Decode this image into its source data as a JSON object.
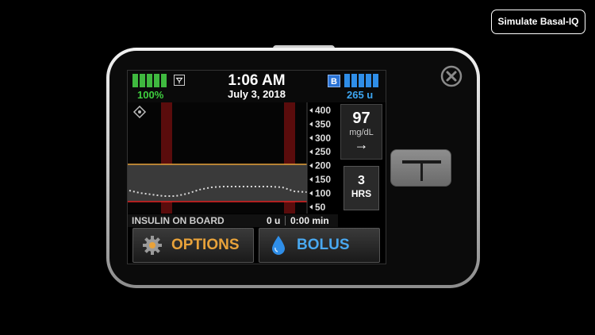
{
  "simulate_button": "Simulate Basal-IQ",
  "status": {
    "battery_percent": "100%",
    "battery_level": 1.0,
    "time": "1:06 AM",
    "date": "July 3, 2018",
    "badge": "B",
    "insulin_units": "265 u"
  },
  "graph": {
    "y_ticks": [
      "400",
      "350",
      "300",
      "250",
      "200",
      "150",
      "100",
      "50"
    ],
    "target_high": 200,
    "target_low": 70,
    "colors": {
      "high_line": "#e6a23a",
      "low_line": "#e02020",
      "trace": "#d8d8d8",
      "suspend_band": "#5a0c0c"
    }
  },
  "cgm": {
    "value": "97",
    "unit": "mg/dL",
    "trend": "→",
    "hours_value": "3",
    "hours_label": "HRS"
  },
  "iob": {
    "label": "INSULIN ON BOARD",
    "units": "0 u",
    "time": "0:00 min"
  },
  "buttons": {
    "options": "OPTIONS",
    "bolus": "BOLUS"
  },
  "icons": [
    "close-icon",
    "signal-icon",
    "diamond-icon",
    "gear-icon",
    "drop-icon",
    "t-button-icon"
  ]
}
